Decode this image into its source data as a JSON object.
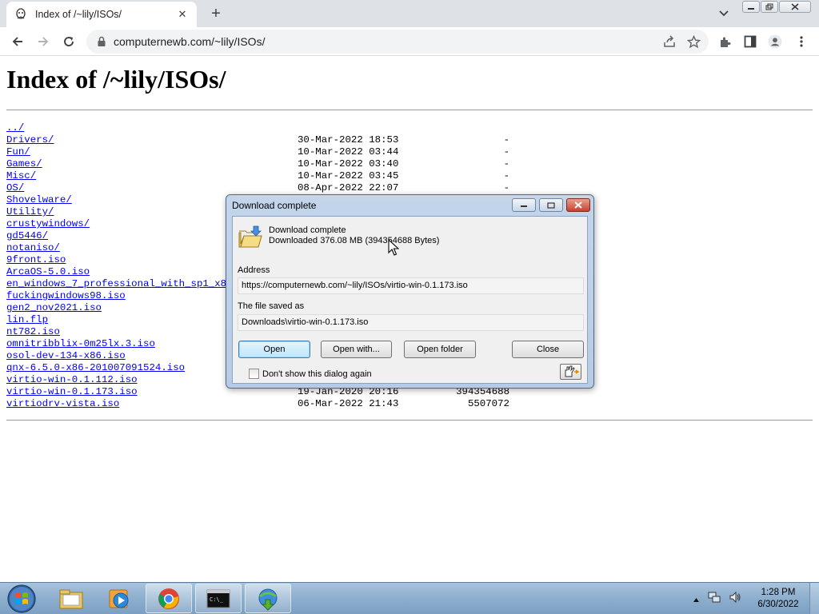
{
  "browser": {
    "tab_title": "Index of /~lily/ISOs/",
    "url": "computernewb.com/~lily/ISOs/"
  },
  "page": {
    "heading": "Index of /~lily/ISOs/",
    "entries": [
      {
        "name": "../",
        "date": "",
        "size": ""
      },
      {
        "name": "Drivers/",
        "date": "30-Mar-2022 18:53",
        "size": "-"
      },
      {
        "name": "Fun/",
        "date": "10-Mar-2022 03:44",
        "size": "-"
      },
      {
        "name": "Games/",
        "date": "10-Mar-2022 03:40",
        "size": "-"
      },
      {
        "name": "Misc/",
        "date": "10-Mar-2022 03:45",
        "size": "-"
      },
      {
        "name": "OS/",
        "date": "08-Apr-2022 22:07",
        "size": "-"
      },
      {
        "name": "Shovelware/",
        "date": "",
        "size": ""
      },
      {
        "name": "Utility/",
        "date": "",
        "size": ""
      },
      {
        "name": "crustywindows/",
        "date": "",
        "size": ""
      },
      {
        "name": "gd5446/",
        "date": "",
        "size": ""
      },
      {
        "name": "notaniso/",
        "date": "",
        "size": ""
      },
      {
        "name": "9front.iso",
        "date": "",
        "size": ""
      },
      {
        "name": "ArcaOS-5.0.iso",
        "date": "",
        "size": ""
      },
      {
        "name": "en_windows_7_professional_with_sp1_x86",
        "date": "",
        "size": ""
      },
      {
        "name": "fuckingwindows98.iso",
        "date": "",
        "size": ""
      },
      {
        "name": "gen2_nov2021.iso",
        "date": "",
        "size": ""
      },
      {
        "name": "lin.flp",
        "date": "",
        "size": ""
      },
      {
        "name": "nt782.iso",
        "date": "",
        "size": ""
      },
      {
        "name": "omnitribblix-0m25lx.3.iso",
        "date": "",
        "size": ""
      },
      {
        "name": "osol-dev-134-x86.iso",
        "date": "",
        "size": ""
      },
      {
        "name": "qnx-6.5.0-x86-201007091524.iso",
        "date": "",
        "size": ""
      },
      {
        "name": "virtio-win-0.1.112.iso",
        "date": "",
        "size": ""
      },
      {
        "name": "virtio-win-0.1.173.iso",
        "date": "19-Jan-2020 20:16",
        "size": "394354688"
      },
      {
        "name": "virtiodrv-vista.iso",
        "date": "06-Mar-2022 21:43",
        "size": "5507072"
      }
    ]
  },
  "dialog": {
    "title": "Download complete",
    "status_line": "Download complete",
    "detail_line": "Downloaded 376.08  MB (394354688 Bytes)",
    "address_label": "Address",
    "address_value": "https://computernewb.com/~lily/ISOs/virtio-win-0.1.173.iso",
    "saved_label": "The file saved as",
    "saved_value": "Downloads\\virtio-win-0.1.173.iso",
    "open_label": "Open",
    "open_with_label": "Open with...",
    "open_folder_label": "Open folder",
    "close_label": "Close",
    "dont_show_label": "Don't show this dialog again",
    "dont_show_checked": false
  },
  "taskbar": {
    "time": "1:28 PM",
    "date": "6/30/2022",
    "items": [
      "explorer-icon",
      "media-player-icon",
      "chrome-icon",
      "cmd-icon",
      "idm-icon"
    ]
  }
}
